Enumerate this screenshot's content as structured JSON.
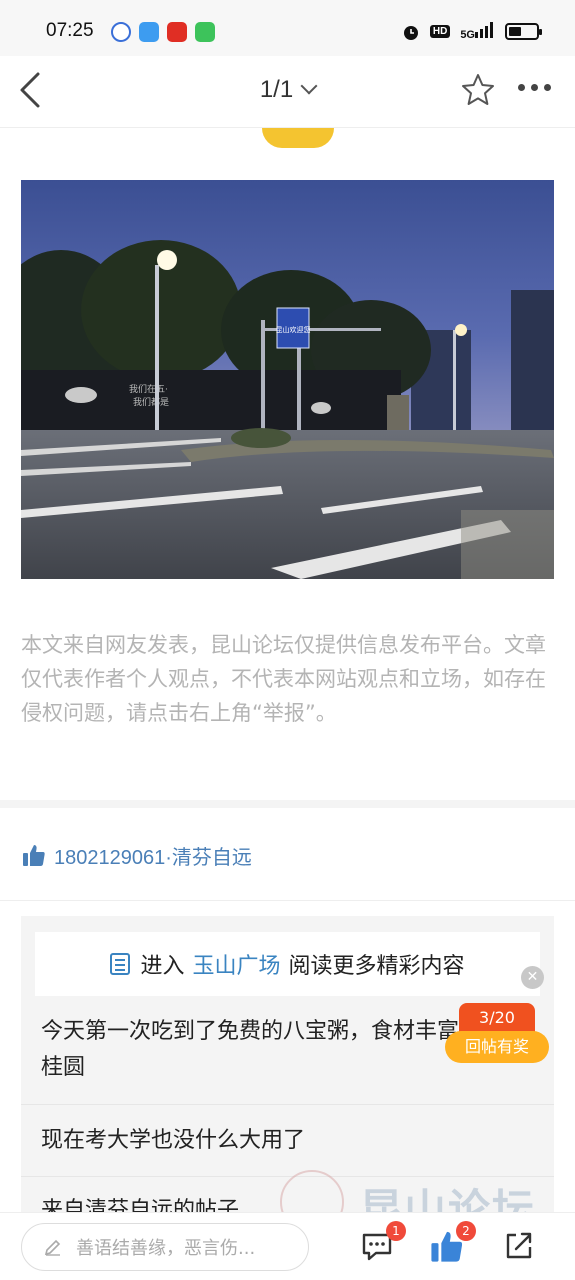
{
  "status_bar": {
    "time": "07:25",
    "hd": "HD",
    "signal": "5G",
    "battery_level": 0.45
  },
  "nav": {
    "page_indicator": "1/1"
  },
  "disclaimer": "本文来自网友发表，昆山论坛仅提供信息发布平台。文章仅代表作者个人观点，不代表本网站观点和立场，如存在侵权问题，请点击右上角“举报”。",
  "likes": {
    "text": "1802129061·清芬自远"
  },
  "related": {
    "enter_prefix": "进入",
    "enter_link": "玉山广场",
    "enter_suffix": "阅读更多精彩内容",
    "items": [
      "今天第一次吃到了免费的八宝粥，食材丰富吃到的桂圆",
      "现在考大学也没什么大用了",
      "来自清芬自远的帖子"
    ]
  },
  "reward": {
    "count": "3/20",
    "label": "回帖有奖"
  },
  "watermark": "昆山论坛",
  "bottom_bar": {
    "comment_placeholder": "善语结善缘，恶言伤...",
    "comment_badge": "1",
    "like_badge": "2"
  },
  "photo": {
    "sign_text": "昆山欢迎您",
    "wall_text_1": "我们在五·",
    "wall_text_2": "我们都是"
  }
}
